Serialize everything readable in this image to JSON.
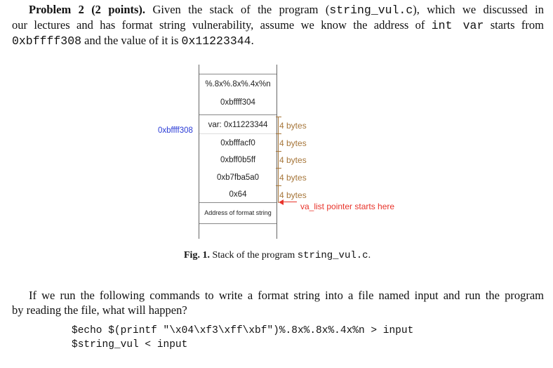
{
  "problem": {
    "heading": "Problem 2 (2 points).",
    "intro_1": "Given the stack of the program (",
    "program_file": "string_vul.c",
    "intro_2": "), which we discussed in",
    "line2_a": "our lectures and has format string vulnerability, assume we know the address of",
    "int_var": "int var",
    "line2_b": "starts from",
    "address": "0xbffff308",
    "line3_mid": "and the value of it is",
    "value": "0x11223344",
    "line3_end": "."
  },
  "diagram": {
    "cells": [
      "%.8x%.8x%.4x%n",
      "0xbffff304",
      "var: 0x11223344",
      "0xbfffacf0",
      "0xbff0b5ff",
      "0xb7fba5a0",
      "0x64",
      "Address of format string"
    ],
    "address_label": "0xbffff308",
    "byte_labels": [
      "4 bytes",
      "4 bytes",
      "4 bytes",
      "4 bytes",
      "4 bytes"
    ],
    "pointer_label": "va_list pointer starts here",
    "colors": {
      "address": "#2a3bd6",
      "bytes": "#a6763a",
      "pointer": "#e8332a"
    }
  },
  "caption": {
    "label": "Fig. 1.",
    "text": "Stack of the program",
    "file": "string_vul.c",
    "end": "."
  },
  "question": {
    "line1": "If we run the following commands to write a format string into a file named input and run the program",
    "line2": "by reading the file, what will happen?"
  },
  "commands": [
    "$echo $(printf \"\\x04\\xf3\\xff\\xbf\")%.8x%.8x%.4x%n > input",
    "$string_vul < input"
  ]
}
